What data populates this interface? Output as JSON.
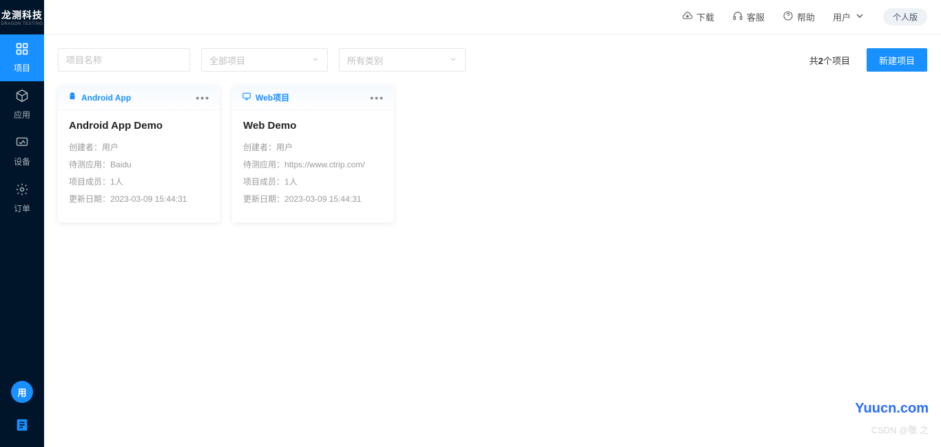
{
  "logo": {
    "main": "龙测科技",
    "sub": "DRAGON TESTING"
  },
  "sidebar": {
    "items": [
      {
        "label": "项目"
      },
      {
        "label": "应用"
      },
      {
        "label": "设备"
      },
      {
        "label": "订单"
      }
    ],
    "bottom": {
      "avatar": "用"
    }
  },
  "header": {
    "download": "下载",
    "service": "客服",
    "help": "帮助",
    "user": "用户",
    "badge": "个人版"
  },
  "toolbar": {
    "search_placeholder": "项目名称",
    "select1": "全部项目",
    "select2": "所有类别",
    "count_prefix": "共",
    "count_value": "2",
    "count_suffix": "个项目",
    "new_project": "新建项目"
  },
  "cards": [
    {
      "type": "Android App",
      "title": "Android App Demo",
      "creator_label": "创建者：",
      "creator": "用户",
      "app_label": "待测应用：",
      "app": "Baidu",
      "members_label": "项目成员：",
      "members": "1人",
      "date_label": "更新日期：",
      "date": "2023-03-09 15:44:31"
    },
    {
      "type": "Web项目",
      "title": "Web Demo",
      "creator_label": "创建者：",
      "creator": "用户",
      "app_label": "待测应用：",
      "app": "https://www.ctrip.com/",
      "members_label": "项目成员：",
      "members": "1人",
      "date_label": "更新日期：",
      "date": "2023-03-09 15:44:31"
    }
  ],
  "watermark1": "Yuucn.com",
  "watermark2": "CSDN @敬 之"
}
